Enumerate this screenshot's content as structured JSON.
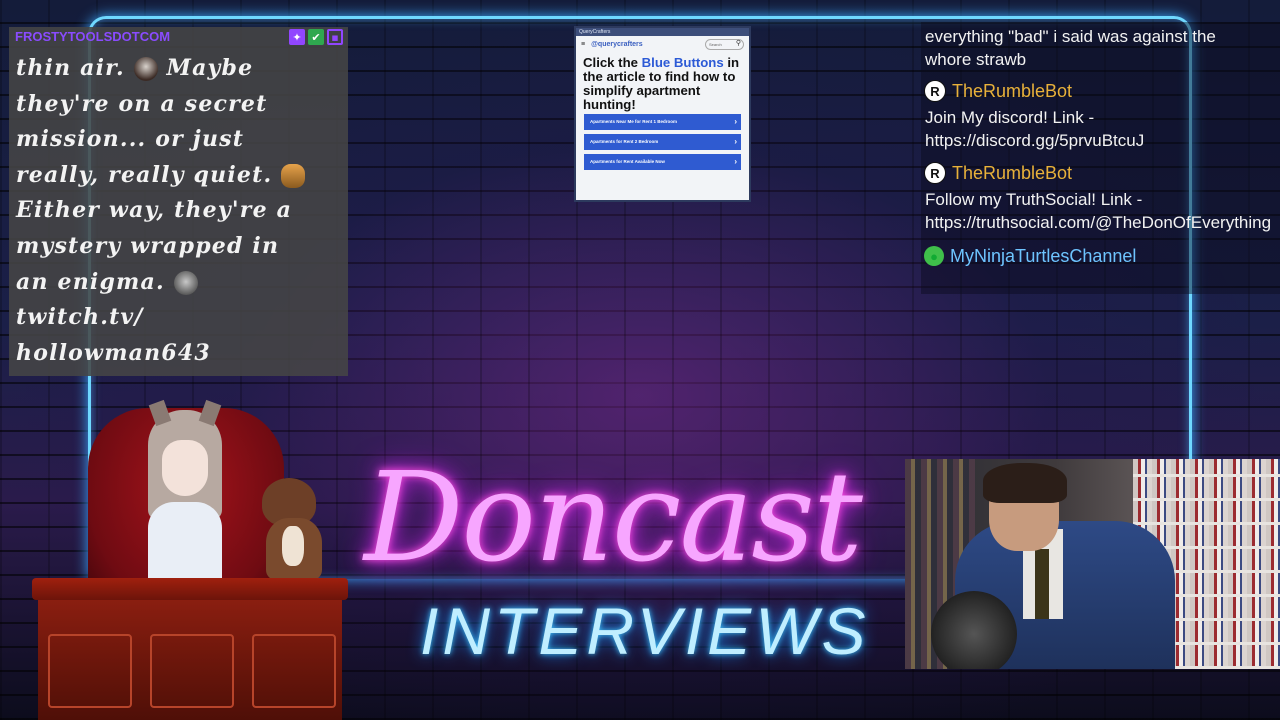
{
  "left_chat": {
    "username": "FROSTYTOOLSDOTCOM",
    "badges": [
      "prime-gaming-badge",
      "verified-badge",
      "twitch-badge"
    ],
    "message": {
      "line1": "thin air.",
      "line1b": "Maybe",
      "line2": "they're on a secret",
      "line3": "mission... or just",
      "line4": "really, really quiet.",
      "line5": "Either way, they're a",
      "line6": "mystery wrapped in",
      "line7": "an enigma.",
      "line8": "twitch.tv/",
      "line9": "hollowman643"
    }
  },
  "ad": {
    "window_title": "QueryCrafters",
    "logo": "@querycrafters",
    "search_placeholder": "Search",
    "headline_pre": "Click the ",
    "headline_highlight": "Blue Buttons",
    "headline_post": " in the article to find how to simplify apartment hunting!",
    "buttons": [
      "Apartments Near Me for Rent 1 Bedroom",
      "Apartments for Rent 2 Bedroom",
      "Apartments for Rent Available Now"
    ]
  },
  "right_chat": {
    "messages": [
      {
        "text1": "everything \"bad\" i said was against the",
        "text2": "whore strawb"
      },
      {
        "user": "TheRumbleBot",
        "text1": "Join My discord! Link -",
        "text2": "https://discord.gg/5prvuBtcuJ"
      },
      {
        "user": "TheRumbleBot",
        "text1": "Follow my TruthSocial! Link -",
        "text2": "https://truthsocial.com/@TheDonOfEverything"
      },
      {
        "user": "MyNinjaTurtlesChannel"
      }
    ],
    "colors": {
      "rumble_name": "#e8b13a",
      "ninja_name": "#6ec4ff"
    }
  },
  "logo": {
    "title": "Doncast",
    "subtitle": "INTERVIEWS"
  }
}
